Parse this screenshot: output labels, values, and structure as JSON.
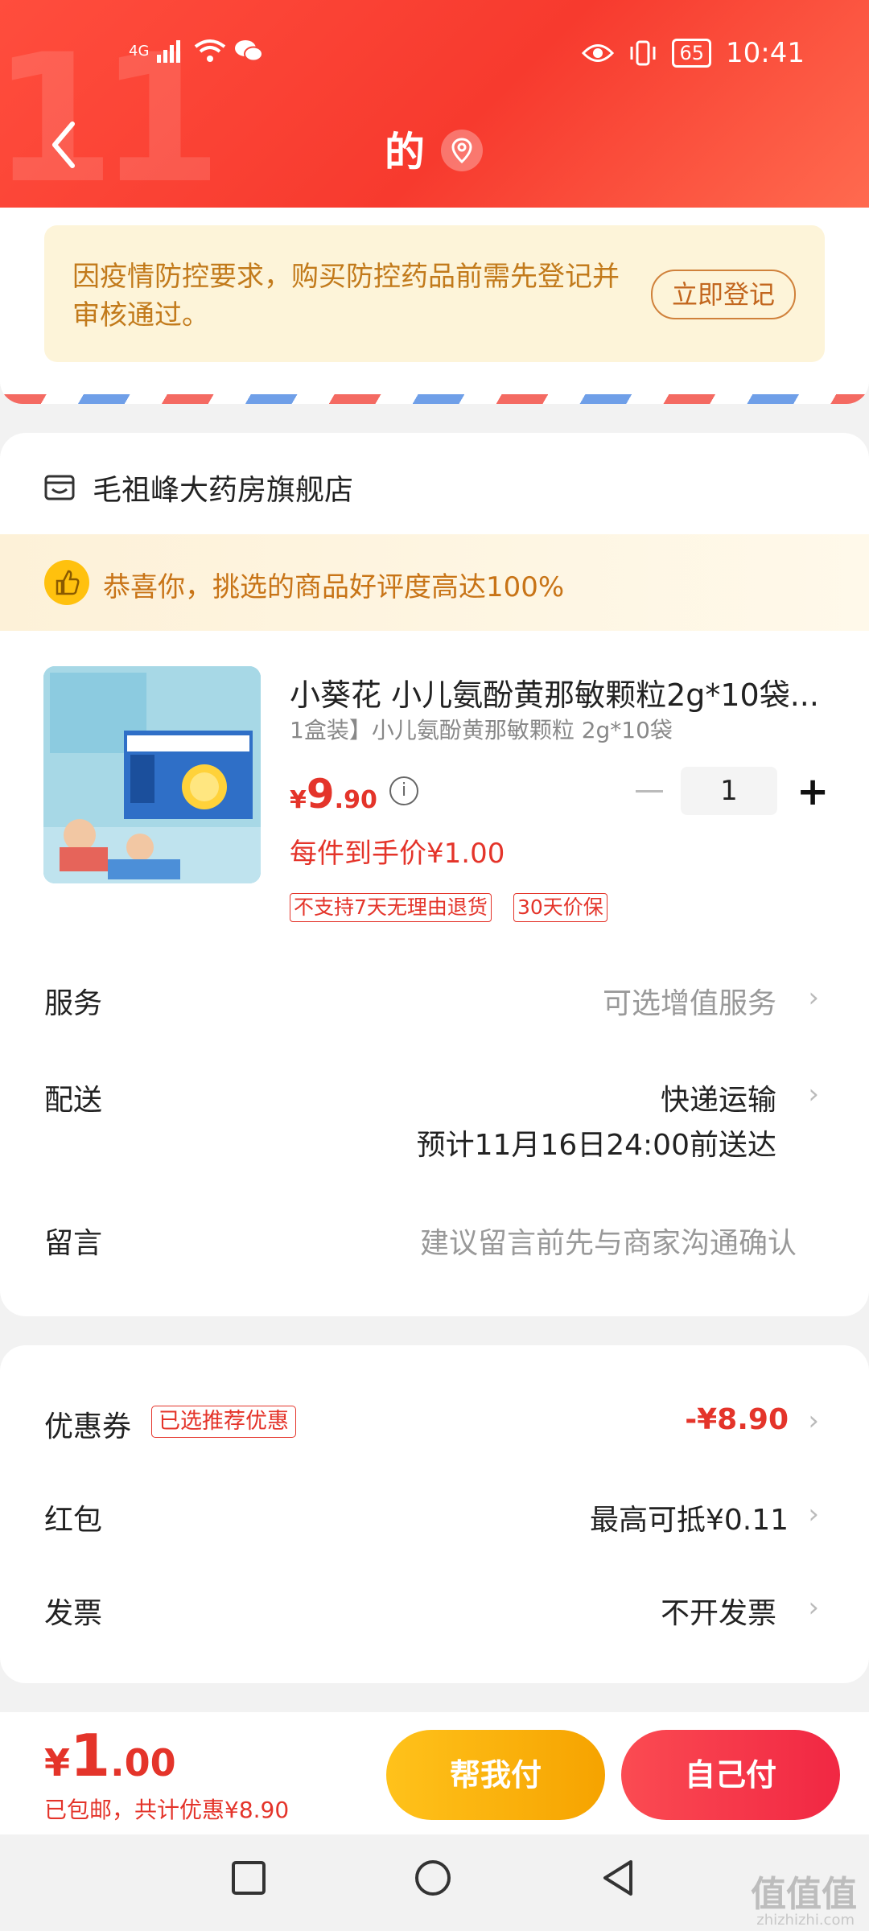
{
  "status_bar": {
    "signal": "4G",
    "battery": "65",
    "time": "10:41"
  },
  "nav": {
    "title": "的"
  },
  "notice": {
    "text": "因疫情防控要求，购买防控药品前需先登记并审核通过。",
    "button": "立即登记"
  },
  "shop": {
    "name": "毛祖峰大药房旗舰店"
  },
  "praise": {
    "text": "恭喜你，挑选的商品好评度高达100%"
  },
  "product": {
    "title": "小葵花 小儿氨酚黄那敏颗粒2g*10袋...",
    "subtitle": "1盒装】小儿氨酚黄那敏颗粒 2g*10袋",
    "price_symbol": "¥",
    "price_int": "9",
    "price_dec": ".90",
    "quantity": "1",
    "unit_price": "每件到手价¥1.00",
    "tags": [
      "不支持7天无理由退货",
      "30天价保"
    ]
  },
  "service": {
    "label": "服务",
    "value": "可选增值服务"
  },
  "delivery": {
    "label": "配送",
    "value": "快递运输",
    "eta": "预计11月16日24:00前送达"
  },
  "message": {
    "label": "留言",
    "placeholder": "建议留言前先与商家沟通确认"
  },
  "coupon": {
    "label": "优惠券",
    "badge": "已选推荐优惠",
    "value": "-¥8.90"
  },
  "redpacket": {
    "label": "红包",
    "value": "最高可抵¥0.11"
  },
  "invoice": {
    "label": "发票",
    "value": "不开发票"
  },
  "footer": {
    "total_symbol": "¥",
    "total_int": "1",
    "total_dec": ".00",
    "shipping": "已包邮，共计优惠¥8.90",
    "help_pay": "帮我付",
    "self_pay": "自己付"
  },
  "watermark": {
    "main": "值值值",
    "sub": "zhizhizhi.com"
  },
  "colors": {
    "brand": "#f73a2e",
    "price": "#e4342a",
    "help_button": "#ffb612",
    "self_button": "#f3303f"
  }
}
